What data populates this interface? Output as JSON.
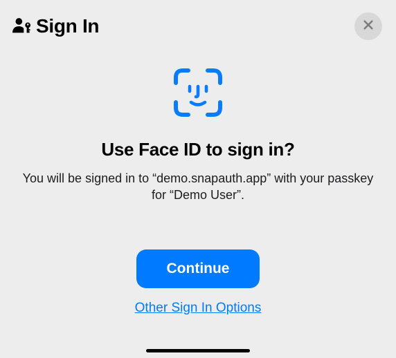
{
  "header": {
    "title": "Sign In"
  },
  "prompt": {
    "title": "Use Face ID to sign in?",
    "body": "You will be signed in to “demo.snapauth.app” with your passkey for “Demo User”."
  },
  "actions": {
    "continue_label": "Continue",
    "other_options_label": "Other Sign In Options"
  },
  "colors": {
    "accent": "#007aff"
  }
}
